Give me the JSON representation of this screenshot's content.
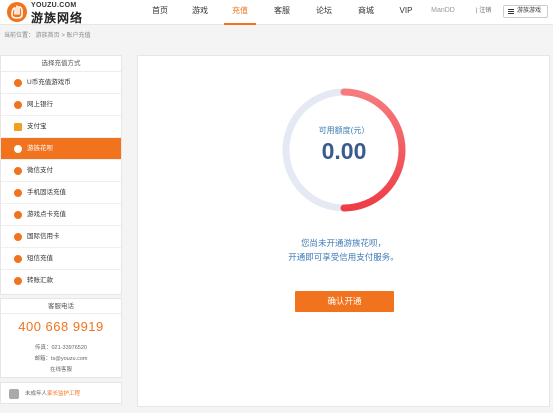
{
  "brand": {
    "logo_en": "YOUZU.COM",
    "logo_cn": "游族网络"
  },
  "nav": {
    "items": [
      "首页",
      "游戏",
      "充值",
      "客服",
      "论坛",
      "商城",
      "VIP",
      "ManDD"
    ],
    "active": "充值",
    "logout": "| 注销",
    "menu_label": "游族游戏"
  },
  "breadcrumb": "当前位置： 游族首页 > 账户充值",
  "sidebar": {
    "title": "选择充值方式",
    "items": [
      {
        "label": "U币充值游戏币",
        "icon": "ubi-icon"
      },
      {
        "label": "网上银行",
        "icon": "bank-icon"
      },
      {
        "label": "支付宝",
        "icon": "alipay-icon"
      },
      {
        "label": "游族花呗",
        "icon": "huabei-icon",
        "active": true
      },
      {
        "label": "微信支付",
        "icon": "wechat-icon"
      },
      {
        "label": "手机固话充值",
        "icon": "phone-icon"
      },
      {
        "label": "游戏点卡充值",
        "icon": "card-icon"
      },
      {
        "label": "国际信用卡",
        "icon": "credit-card-icon"
      },
      {
        "label": "短信充值",
        "icon": "sms-icon"
      },
      {
        "label": "转账汇款",
        "icon": "transfer-icon"
      }
    ]
  },
  "hotline": {
    "title": "客服电话",
    "number": "400 668 9919",
    "fax": "传真：021-33976520",
    "email": "邮箱：ts@youzu.com",
    "online": "在线客服"
  },
  "guardian": {
    "prefix": "未成年人",
    "link": "家长监护工程"
  },
  "main": {
    "balance_label": "可用额度(元）",
    "balance_value": "0.00",
    "notice_line1": "您尚未开通游族花呗，",
    "notice_line2": "开通即可享受信用支付服务。",
    "confirm_label": "确认开通"
  },
  "colors": {
    "accent": "#f2731e",
    "ring_start": "#f04a4f",
    "ring_end": "#f77b7e",
    "ring_track": "#e4e9f3",
    "info_text": "#3e7bb8"
  }
}
